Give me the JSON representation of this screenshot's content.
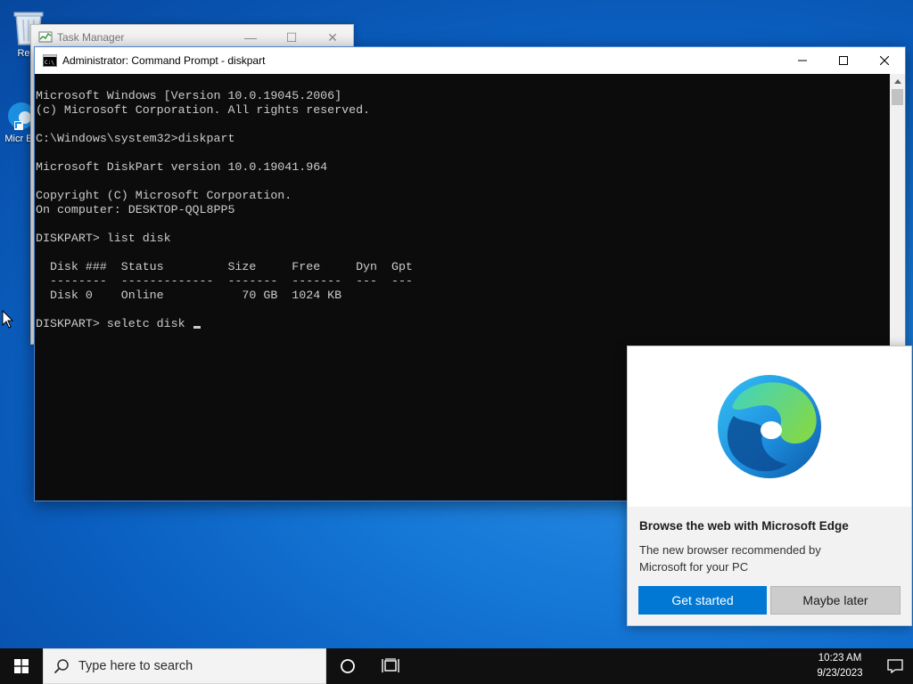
{
  "desktop": {
    "icons": [
      {
        "label": "Recy"
      },
      {
        "label": "Micr Ed"
      }
    ]
  },
  "task_manager": {
    "title": "Task Manager",
    "controls": {
      "minimize": "—",
      "maximize": "☐",
      "close": "✕"
    }
  },
  "cmd": {
    "title": "Administrator: Command Prompt - diskpart",
    "lines": [
      "Microsoft Windows [Version 10.0.19045.2006]",
      "(c) Microsoft Corporation. All rights reserved.",
      "",
      "C:\\Windows\\system32>diskpart",
      "",
      "Microsoft DiskPart version 10.0.19041.964",
      "",
      "Copyright (C) Microsoft Corporation.",
      "On computer: DESKTOP-QQL8PP5",
      "",
      "DISKPART> list disk",
      "",
      "  Disk ###  Status         Size     Free     Dyn  Gpt",
      "  --------  -------------  -------  -------  ---  ---",
      "  Disk 0    Online           70 GB  1024 KB",
      "",
      "DISKPART> seletc disk "
    ]
  },
  "edge_promo": {
    "heading": "Browse the web with Microsoft Edge",
    "body": "The new browser recommended by Microsoft for your PC",
    "primary_button": "Get started",
    "secondary_button": "Maybe later"
  },
  "taskbar": {
    "search_placeholder": "Type here to search",
    "time": "10:23 AM",
    "date": "9/23/2023"
  },
  "colors": {
    "accent": "#0078d4",
    "console_bg": "#0c0c0c",
    "console_text": "#cccccc",
    "taskbar": "#101010"
  },
  "icons": {
    "recycle_bin": "recycle-bin-icon",
    "edge": "edge-icon",
    "cmd": "cmd-icon",
    "task_manager": "task-manager-icon",
    "start": "windows-logo-icon",
    "search": "search-icon",
    "cortana": "cortana-icon",
    "task_view": "task-view-icon",
    "notifications": "notification-icon"
  }
}
